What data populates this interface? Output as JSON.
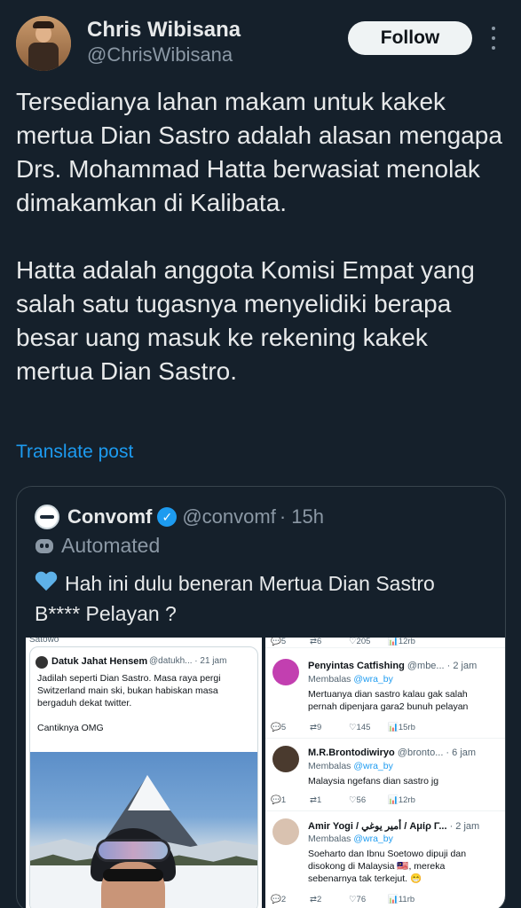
{
  "post": {
    "author_name": "Chris Wibisana",
    "author_handle": "@ChrisWibisana",
    "follow_label": "Follow",
    "text": "Tersedianya lahan makam untuk kakek mertua Dian Sastro adalah alasan mengapa Drs. Mohammad Hatta berwasiat menolak dimakamkan di Kalibata.\n\nHatta adalah anggota Komisi Empat yang salah satu tugasnya menyelidiki berapa besar uang masuk ke rekening kakek mertua Dian Sastro.",
    "translate_label": "Translate post"
  },
  "quote": {
    "name": "Convomf",
    "handle": "@convomf",
    "time": "· 15h",
    "automated_label": "Automated",
    "text": "Hah ini dulu beneran Mertua Dian Sastro\nB**** Pelayan ?",
    "left_image": {
      "top_crop": "Satowo",
      "author": "Datuk Jahat Hensem",
      "meta": "@datukh... · 21 jam",
      "text": "Jadilah seperti Dian Sastro. Masa raya pergi\nSwitzerland main ski, bukan habiskan masa\nbergaduh dekat twitter.\n\nCantiknya OMG"
    },
    "right_image": {
      "top_stats": [
        "5",
        "6",
        "205",
        "12rb"
      ],
      "replies": [
        {
          "name": "Penyintas Catfishing",
          "meta": "@mbe... · 2 jam",
          "reply_prefix": "Membalas",
          "reply_to": "@wra_by",
          "text": "Mertuanya dian sastro kalau gak salah\npernah dipenjara gara2 bunuh pelayan",
          "stats": [
            "5",
            "9",
            "145",
            "15rb"
          ]
        },
        {
          "name": "M.R.Brontodiwiryo",
          "meta": "@bronto... · 6 jam",
          "reply_prefix": "Membalas",
          "reply_to": "@wra_by",
          "text": "Malaysia ngefans dian sastro jg",
          "stats": [
            "1",
            "1",
            "56",
            "12rb"
          ]
        },
        {
          "name": "Amir Yogi / أمير يوغي / Aμίρ Γ...",
          "meta": "· 2 jam",
          "reply_prefix": "Membalas",
          "reply_to": "@wra_by",
          "text": "Soeharto dan Ibnu Soetowo dipuji dan\ndisokong di Malaysia 🇲🇾, mereka\nsebenarnya tak terkejut. 😁",
          "stats": [
            "2",
            "2",
            "76",
            "11rb"
          ]
        }
      ]
    }
  },
  "colors": {
    "background": "#15202b",
    "primary_text": "#e7e9ea",
    "secondary_text": "#8b98a5",
    "link": "#1d9bf0",
    "border": "#38444d"
  },
  "icons": [
    "more-vertical-icon",
    "verified-badge-icon",
    "bot-icon",
    "blue-heart-icon",
    "reply-icon",
    "retweet-icon",
    "like-icon",
    "views-icon",
    "bookmark-icon",
    "share-icon"
  ]
}
